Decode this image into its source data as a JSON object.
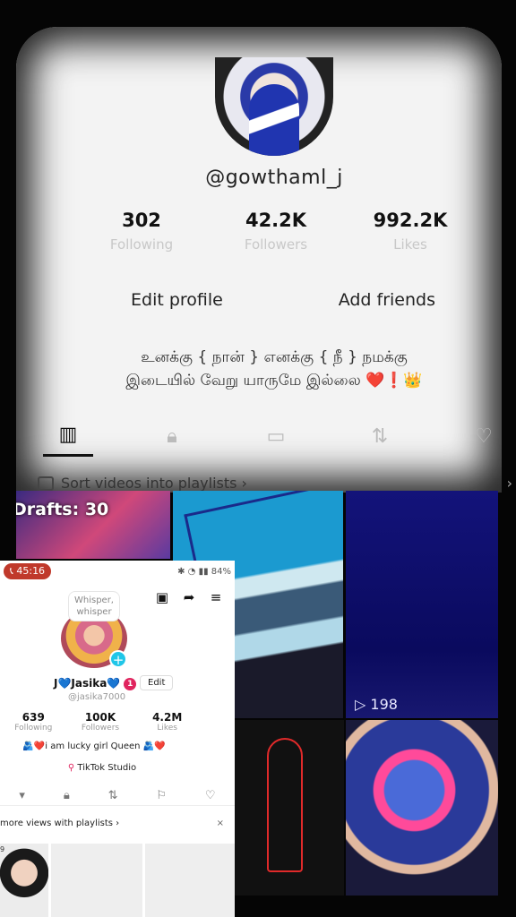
{
  "background_profile": {
    "username": "@gowthaml_j",
    "stats": [
      {
        "value": "302",
        "label": "Following"
      },
      {
        "value": "42.2K",
        "label": "Followers"
      },
      {
        "value": "992.2K",
        "label": "Likes"
      }
    ],
    "buttons": {
      "edit": "Edit profile",
      "add": "Add friends"
    },
    "bio_line1": "உனக்கு { நான் } எனக்கு { நீ } நமக்கு",
    "bio_line2": "இடையில் வேறு யாருமே இல்லை ❤️❗👑",
    "tabs": [
      "videos-icon",
      "lock-icon",
      "tagged-icon",
      "repost-icon",
      "liked-icon"
    ],
    "playlist_prompt": "Sort videos into playlists ›",
    "grid": {
      "drafts_label": "Drafts: 30",
      "views": "198"
    }
  },
  "phone": {
    "call_time": "45:16",
    "battery": "84%",
    "note": "Whisper, whisper",
    "name": "J💙Jasika💙",
    "badge": "1",
    "edit_label": "Edit",
    "handle": "@jasika7000",
    "stats": [
      {
        "value": "639",
        "label": "Following"
      },
      {
        "value": "100K",
        "label": "Followers"
      },
      {
        "value": "4.2M",
        "label": "Likes"
      }
    ],
    "bio": "🫂❤️i am lucky girl Queen 🫂❤️",
    "studio": "TikTok Studio",
    "playlist_prompt": "more views with playlists ›",
    "close": "×",
    "grid_count": "9"
  }
}
